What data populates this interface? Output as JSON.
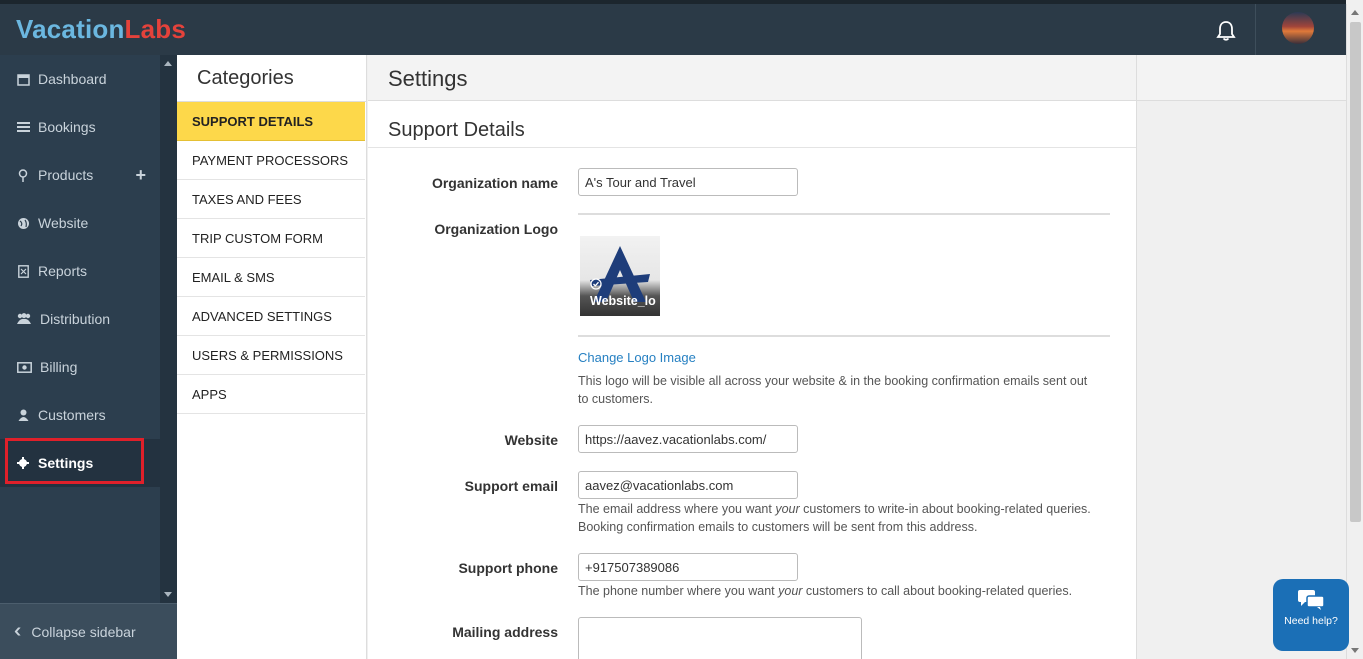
{
  "header": {
    "brand_part1": "Vacation",
    "brand_part2": "Labs",
    "notification_icon": "bell-icon",
    "avatar_icon": "user-avatar"
  },
  "sidebar": {
    "items": [
      {
        "label": "Dashboard",
        "icon": "calendar-icon"
      },
      {
        "label": "Bookings",
        "icon": "list-icon"
      },
      {
        "label": "Products",
        "icon": "map-pin-icon",
        "action": "+"
      },
      {
        "label": "Website",
        "icon": "globe-icon"
      },
      {
        "label": "Reports",
        "icon": "report-icon"
      },
      {
        "label": "Distribution",
        "icon": "users-icon"
      },
      {
        "label": "Billing",
        "icon": "money-icon"
      },
      {
        "label": "Customers",
        "icon": "user-icon"
      },
      {
        "label": "Settings",
        "icon": "gear-icon",
        "active": true
      }
    ],
    "collapse_label": "Collapse sidebar",
    "highlight_color": "#e0202a"
  },
  "categories": {
    "title": "Categories",
    "items": [
      "SUPPORT DETAILS",
      "PAYMENT PROCESSORS",
      "TAXES AND FEES",
      "TRIP CUSTOM FORM",
      "EMAIL & SMS",
      "ADVANCED SETTINGS",
      "USERS & PERMISSIONS",
      "APPS"
    ],
    "active_index": 0,
    "active_color": "#fdd84a"
  },
  "settings": {
    "title": "Settings",
    "section_title": "Support Details",
    "org_name_label": "Organization name",
    "org_name_value": "A's Tour and Travel",
    "org_logo_label": "Organization Logo",
    "logo_caption": "Website_lo",
    "change_logo_link": "Change Logo Image",
    "logo_help": "This logo will be visible all across your website & in the booking confirmation emails sent out to customers.",
    "website_label": "Website",
    "website_value": "https://aavez.vacationlabs.com/",
    "support_email_label": "Support email",
    "support_email_value": "aavez@vacationlabs.com",
    "email_help_pre": "The email address where you want ",
    "email_help_em": "your",
    "email_help_post": " customers to write-in about booking-related queries. Booking confirmation emails to customers will be sent from this address.",
    "support_phone_label": "Support phone",
    "support_phone_value": "+917507389086",
    "phone_help_pre": "The phone number where you want ",
    "phone_help_em": "your",
    "phone_help_post": " customers to call about booking-related queries.",
    "mailing_address_label": "Mailing address",
    "mailing_address_value": ""
  },
  "help_widget": {
    "label": "Need help?",
    "icon": "chat-bubbles-icon"
  },
  "colors": {
    "topbar": "#2b3a47",
    "sidebar": "#2c3e4e",
    "link": "#2680c2"
  }
}
